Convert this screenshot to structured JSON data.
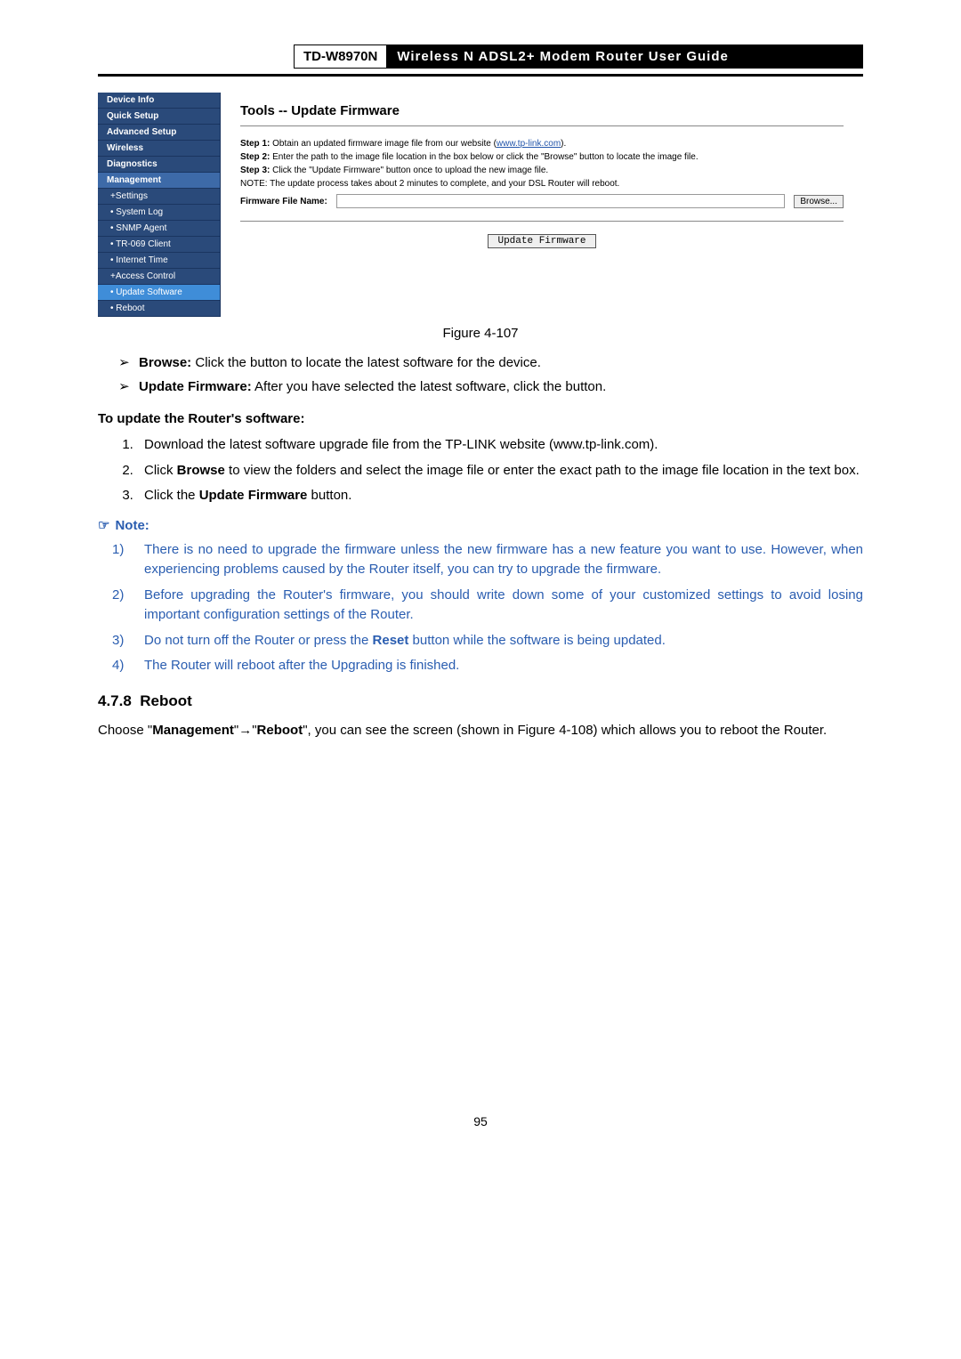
{
  "header": {
    "model": "TD-W8970N",
    "title": "Wireless N ADSL2+ Modem Router User Guide"
  },
  "screenshot": {
    "nav": {
      "items": [
        {
          "label": "Device Info",
          "cls": ""
        },
        {
          "label": "Quick Setup",
          "cls": ""
        },
        {
          "label": "Advanced Setup",
          "cls": ""
        },
        {
          "label": "Wireless",
          "cls": ""
        },
        {
          "label": "Diagnostics",
          "cls": ""
        },
        {
          "label": "Management",
          "cls": "nav-active"
        },
        {
          "label": "+Settings",
          "cls": "nav-sub"
        },
        {
          "label": "• System Log",
          "cls": "nav-sub"
        },
        {
          "label": "• SNMP Agent",
          "cls": "nav-sub"
        },
        {
          "label": "• TR-069 Client",
          "cls": "nav-sub"
        },
        {
          "label": "• Internet Time",
          "cls": "nav-sub"
        },
        {
          "label": "+Access Control",
          "cls": "nav-sub"
        },
        {
          "label": "• Update Software",
          "cls": "nav-sub nav-highlight"
        },
        {
          "label": "• Reboot",
          "cls": "nav-sub"
        }
      ]
    },
    "content": {
      "title": "Tools -- Update Firmware",
      "step1_pre": "Step 1:",
      "step1": " Obtain an updated firmware image file from our website (",
      "step1_link": "www.tp-link.com",
      "step1_post": ").",
      "step2_pre": "Step 2:",
      "step2": " Enter the path to the image file location in the box below or click the \"Browse\" button to locate the image file.",
      "step3_pre": "Step 3:",
      "step3": " Click the \"Update Firmware\" button once to upload the new image file.",
      "note": "NOTE: The update process takes about 2 minutes to complete, and your DSL Router will reboot.",
      "file_label": "Firmware File Name:",
      "browse": "Browse...",
      "update_btn": "Update Firmware"
    }
  },
  "caption": "Figure 4-107",
  "bullet_items": {
    "browse_b": "Browse:",
    "browse": " Click the button to locate the latest software for the device.",
    "updatefw_b": "Update Firmware:",
    "updatefw": " After you have selected the latest software, click the button."
  },
  "update_heading": "To update the Router's software:",
  "steps": {
    "s1": "Download the latest software upgrade file from the TP-LINK website (www.tp-link.com).",
    "s2_a": "Click ",
    "s2_b": "Browse",
    "s2_c": " to view the folders and select the image file or enter the exact path to the image file location in the text box.",
    "s3_a": "Click the ",
    "s3_b": "Update Firmware",
    "s3_c": " button."
  },
  "note_label": "Note:",
  "notes": {
    "n1": "There is no need to upgrade the firmware unless the new firmware has a new feature you want to use. However, when experiencing problems caused by the Router itself, you can try to upgrade the firmware.",
    "n2": "Before upgrading the Router's firmware, you should write down some of your customized settings to avoid losing important configuration settings of the Router.",
    "n3_a": "Do not turn off the Router or press the ",
    "n3_b": "Reset",
    "n3_c": " button while the software is being updated.",
    "n4": "The Router will reboot after the Upgrading is finished."
  },
  "section": {
    "num": "4.7.8",
    "title": "Reboot",
    "body_a": "Choose \"",
    "body_b": "Management",
    "body_c": "\"",
    "arrow": "→",
    "body_d": "\"",
    "body_e": "Reboot",
    "body_f": "\", you can see the screen (shown in Figure 4-108) which allows you to reboot the Router."
  },
  "page_num": "95"
}
